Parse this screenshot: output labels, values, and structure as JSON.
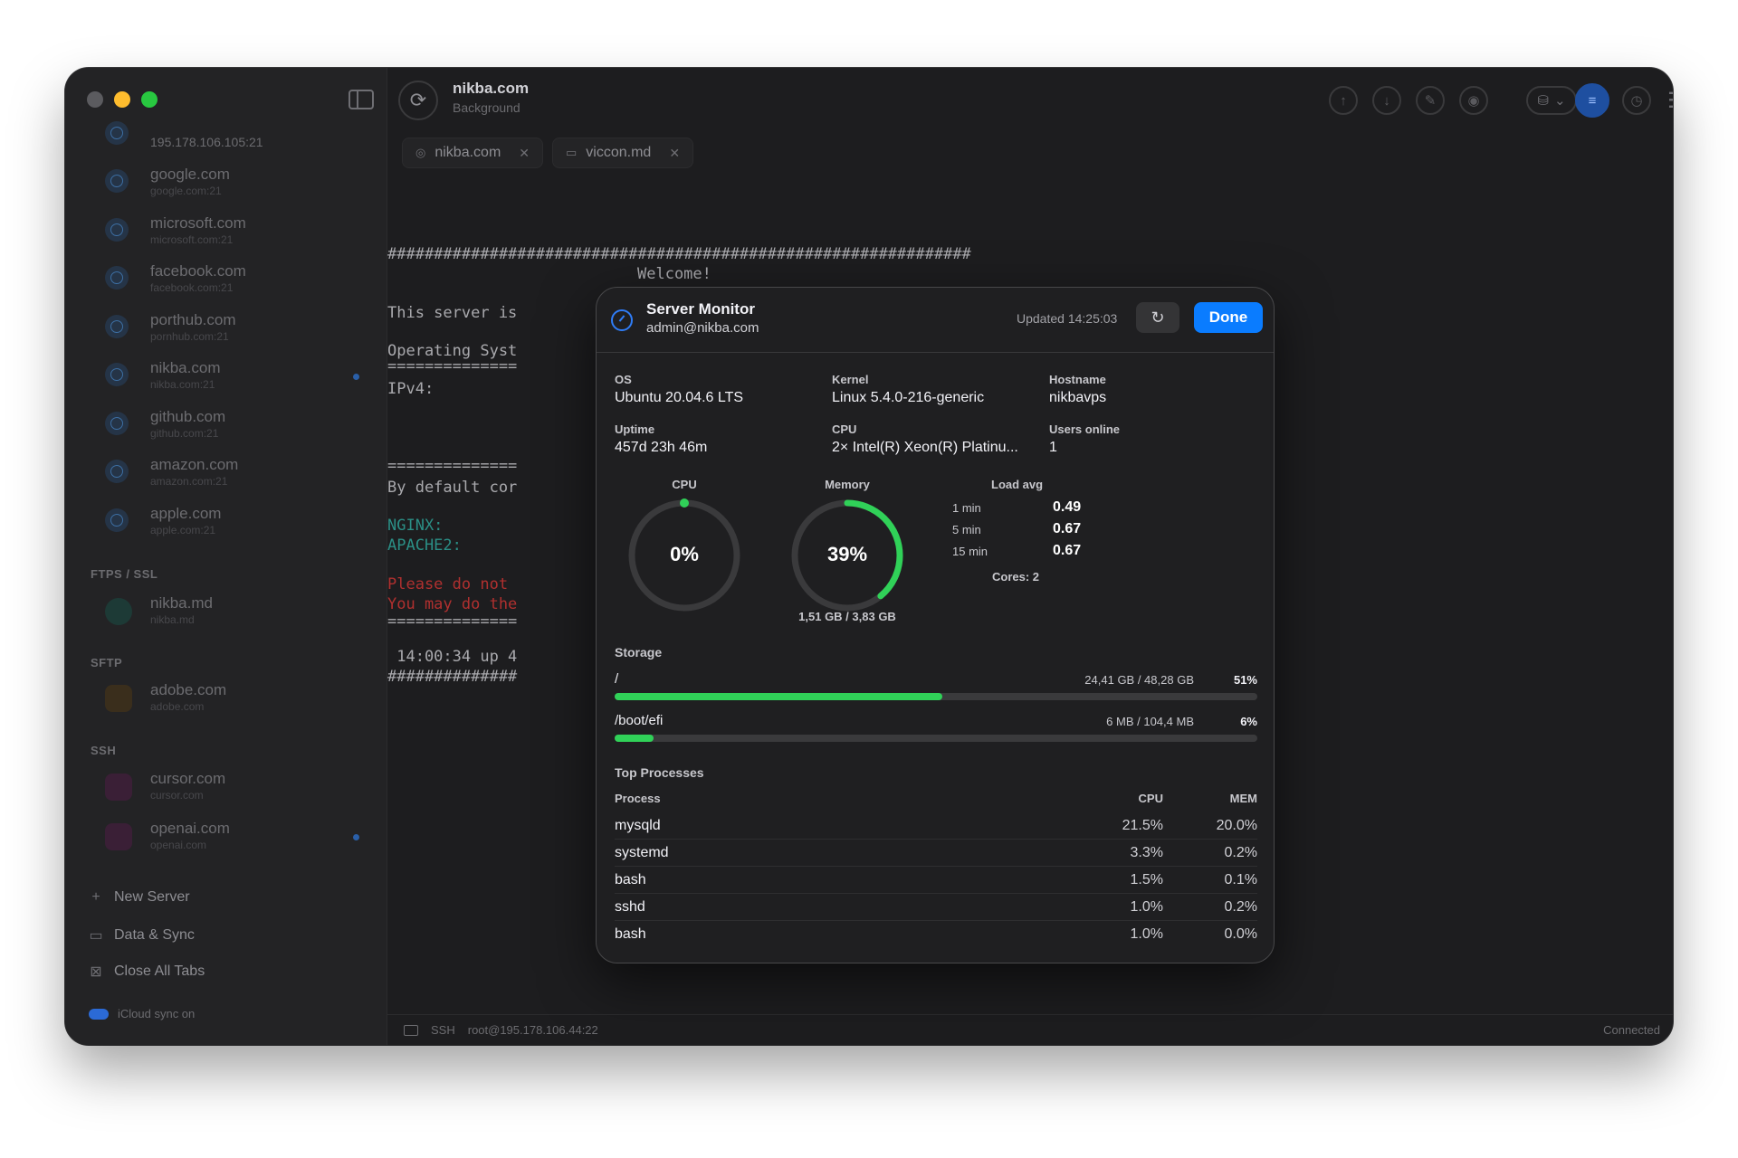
{
  "window": {
    "title": "nikba.com",
    "subtitle": "Background"
  },
  "sidebar": {
    "servers": [
      {
        "name": "",
        "address": "195.178.106.105:21",
        "dot": false
      },
      {
        "name": "google.com",
        "address": "google.com:21",
        "dot": false
      },
      {
        "name": "microsoft.com",
        "address": "microsoft.com:21",
        "dot": false
      },
      {
        "name": "facebook.com",
        "address": "facebook.com:21",
        "dot": false
      },
      {
        "name": "porthub.com",
        "address": "pornhub.com:21",
        "dot": false
      },
      {
        "name": "nikba.com",
        "address": "nikba.com:21",
        "dot": true
      },
      {
        "name": "github.com",
        "address": "github.com:21",
        "dot": false
      },
      {
        "name": "amazon.com",
        "address": "amazon.com:21",
        "dot": false
      },
      {
        "name": "apple.com",
        "address": "apple.com:21",
        "dot": false
      }
    ],
    "sections": {
      "ftps": "FTPS / SSL",
      "sftp": "SFTP",
      "ssh": "SSH"
    },
    "ftps_items": [
      {
        "name": "nikba.md",
        "address": "nikba.md"
      }
    ],
    "sftp_items": [
      {
        "name": "adobe.com",
        "address": "adobe.com"
      }
    ],
    "ssh_items": [
      {
        "name": "cursor.com",
        "address": "cursor.com"
      },
      {
        "name": "openai.com",
        "address": "openai.com"
      }
    ],
    "actions": {
      "new_server": "New Server",
      "data_sync": "Data & Sync",
      "close_tabs": "Close All Tabs"
    },
    "icloud": "iCloud sync on"
  },
  "tabs": [
    {
      "label": "nikba.com"
    },
    {
      "label": "viccon.md"
    }
  ],
  "terminal": {
    "hash_line": "###############################################################",
    "welcome": "Welcome!",
    "line_server": "This server is",
    "line_os": "Operating Syst",
    "line_sep": "==============",
    "line_ipv4": "IPv4:",
    "line_default": "By default cor",
    "line_nginx": "NGINX:",
    "line_apache": "APACHE2:",
    "line_please": "Please do not",
    "line_may": "You may do the",
    "line_uptime": " 14:00:34 up 4",
    "line_hash_short": "##############"
  },
  "statusbar": {
    "protocol": "SSH",
    "address": "root@195.178.106.44:22",
    "status": "Connected"
  },
  "monitor": {
    "title": "Server Monitor",
    "account": "admin@nikba.com",
    "updated": "Updated 14:25:03",
    "done": "Done",
    "os_label": "OS",
    "os": "Ubuntu 20.04.6 LTS",
    "kernel_label": "Kernel",
    "kernel": "Linux 5.4.0-216-generic",
    "hostname_label": "Hostname",
    "hostname": "nikbavps",
    "uptime_label": "Uptime",
    "uptime": "457d 23h 46m",
    "cpu_label": "CPU",
    "cpu": "2× Intel(R) Xeon(R) Platinu...",
    "users_label": "Users online",
    "users": "1",
    "gauges": {
      "cpu_label": "CPU",
      "cpu_text": "0%",
      "cpu_fraction": 0.0,
      "mem_label": "Memory",
      "mem_text": "39%",
      "mem_fraction": 0.39,
      "mem_detail": "1,51 GB / 3,83 GB"
    },
    "load": {
      "title": "Load avg",
      "rows": [
        {
          "k": "1 min",
          "v": "0.49"
        },
        {
          "k": "5 min",
          "v": "0.67"
        },
        {
          "k": "15 min",
          "v": "0.67"
        }
      ],
      "cores": "Cores: 2"
    },
    "storage": {
      "title": "Storage",
      "items": [
        {
          "mount": "/",
          "used": "24,41 GB / 48,28 GB",
          "pct": "51%",
          "fraction": 0.51
        },
        {
          "mount": "/boot/efi",
          "used": "6 MB / 104,4 MB",
          "pct": "6%",
          "fraction": 0.06
        }
      ]
    },
    "processes": {
      "title": "Top Processes",
      "headers": {
        "process": "Process",
        "cpu": "CPU",
        "mem": "MEM"
      },
      "rows": [
        {
          "name": "mysqld",
          "cpu": "21.5%",
          "mem": "20.0%"
        },
        {
          "name": "systemd",
          "cpu": "3.3%",
          "mem": "0.2%"
        },
        {
          "name": "bash",
          "cpu": "1.5%",
          "mem": "0.1%"
        },
        {
          "name": "sshd",
          "cpu": "1.0%",
          "mem": "0.2%"
        },
        {
          "name": "bash",
          "cpu": "1.0%",
          "mem": "0.0%"
        }
      ]
    }
  },
  "colors": {
    "accent": "#0a7cff",
    "gauge": "#30d158",
    "terminal_green": "#2b8f86",
    "terminal_red": "#b0302f"
  }
}
